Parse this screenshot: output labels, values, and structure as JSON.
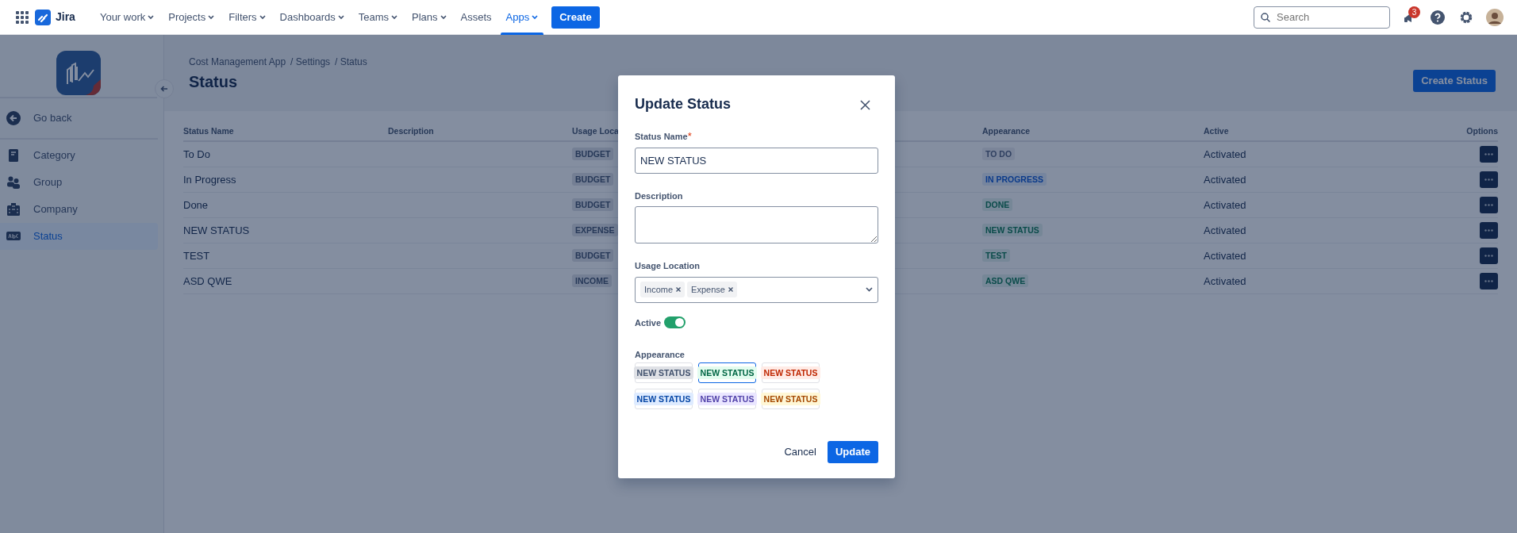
{
  "topbar": {
    "product": "Jira",
    "menu": [
      {
        "label": "Your work",
        "dropdown": true,
        "selected": false
      },
      {
        "label": "Projects",
        "dropdown": true,
        "selected": false
      },
      {
        "label": "Filters",
        "dropdown": true,
        "selected": false
      },
      {
        "label": "Dashboards",
        "dropdown": true,
        "selected": false
      },
      {
        "label": "Teams",
        "dropdown": true,
        "selected": false
      },
      {
        "label": "Plans",
        "dropdown": true,
        "selected": false
      },
      {
        "label": "Assets",
        "dropdown": false,
        "selected": false
      },
      {
        "label": "Apps",
        "dropdown": true,
        "selected": true
      }
    ],
    "create": "Create",
    "search": {
      "placeholder": "Search"
    },
    "notification_count": "3"
  },
  "sidebar": {
    "back": "Go back",
    "items": [
      {
        "label": "Category",
        "kind": "document",
        "selected": false
      },
      {
        "label": "Group",
        "kind": "people",
        "selected": false
      },
      {
        "label": "Company",
        "kind": "building",
        "selected": false
      },
      {
        "label": "Status",
        "kind": "label",
        "selected": true
      }
    ]
  },
  "header": {
    "breadcrumbs": [
      "Cost Management App",
      "/ Settings",
      "/ Status"
    ],
    "title": "Status",
    "create_button": "Create Status"
  },
  "table": {
    "columns": [
      "Status Name",
      "Description",
      "Usage Loca",
      "Appearance",
      "Active",
      "Options"
    ],
    "rows": [
      {
        "name": "To Do",
        "usage": "BUDGET",
        "appearance": {
          "label": "TO DO",
          "color": "#2f3f60"
        },
        "active": "Activated"
      },
      {
        "name": "In Progress",
        "usage": "BUDGET",
        "appearance": {
          "label": "IN PROGRESS",
          "color": "#0b3a8a"
        },
        "active": "Activated"
      },
      {
        "name": "Done",
        "usage": "BUDGET",
        "appearance": {
          "label": "DONE",
          "color": "#0a4b4a"
        },
        "active": "Activated"
      },
      {
        "name": "NEW STATUS",
        "usage": "EXPENSE",
        "appearance": {
          "label": "NEW STATUS",
          "color": "#0a4b4a"
        },
        "active": "Activated"
      },
      {
        "name": "TEST",
        "usage": "BUDGET",
        "appearance": {
          "label": "TEST",
          "color": "#0a4b4a"
        },
        "active": "Activated"
      },
      {
        "name": "ASD QWE",
        "usage": "INCOME",
        "appearance": {
          "label": "ASD QWE",
          "color": "#0a4b4a"
        },
        "active": "Activated"
      }
    ]
  },
  "modal": {
    "title": "Update Status",
    "name_label": "Status Name",
    "required_mark": "*",
    "name_value": "NEW STATUS",
    "description_label": "Description",
    "usage_label": "Usage Location",
    "usage_tags": [
      "Income",
      "Expense"
    ],
    "active_label": "Active",
    "active_on": true,
    "appearance_label": "Appearance",
    "appearance_options": [
      {
        "label": "NEW STATUS",
        "color": "#42526e",
        "selected": false
      },
      {
        "label": "NEW STATUS",
        "color": "#006644",
        "selected": true
      },
      {
        "label": "NEW STATUS",
        "color": "#bf2600",
        "selected": false
      },
      {
        "label": "NEW STATUS",
        "color": "#0747a6",
        "selected": false
      },
      {
        "label": "NEW STATUS",
        "color": "#5243aa",
        "selected": false
      },
      {
        "label": "NEW STATUS",
        "color": "#a54800",
        "selected": false
      }
    ],
    "cancel": "Cancel",
    "update": "Update"
  }
}
